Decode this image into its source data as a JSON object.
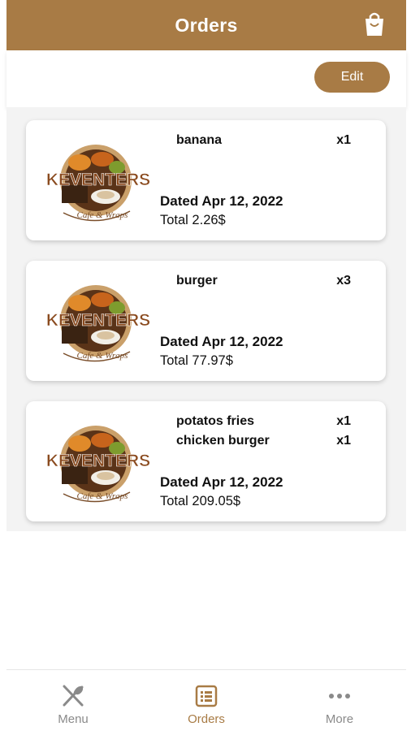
{
  "header": {
    "title": "Orders",
    "cart_icon": "shopping-bag-icon"
  },
  "toolbar": {
    "edit_label": "Edit"
  },
  "brand": {
    "logo_text": "KEVENTERS",
    "logo_tagline": "Cafe & Wraps"
  },
  "orders": [
    {
      "items": [
        {
          "name": "banana",
          "qty": "x1"
        }
      ],
      "date": "Dated Apr 12, 2022",
      "total": "Total 2.26$"
    },
    {
      "items": [
        {
          "name": "burger",
          "qty": "x3"
        }
      ],
      "date": "Dated Apr 12, 2022",
      "total": "Total 77.97$"
    },
    {
      "items": [
        {
          "name": "potatos fries",
          "qty": "x1"
        },
        {
          "name": "chicken burger",
          "qty": "x1"
        }
      ],
      "date": "Dated Apr 12, 2022",
      "total": "Total 209.05$"
    }
  ],
  "bottom_nav": {
    "items": [
      {
        "label": "Menu",
        "icon": "fork-knife-icon",
        "active": false
      },
      {
        "label": "Orders",
        "icon": "list-icon",
        "active": true
      },
      {
        "label": "More",
        "icon": "more-dots-icon",
        "active": false
      }
    ]
  },
  "colors": {
    "primary": "#a87b45",
    "background": "#f3f3f3",
    "inactive_nav": "#8a8a8a"
  }
}
